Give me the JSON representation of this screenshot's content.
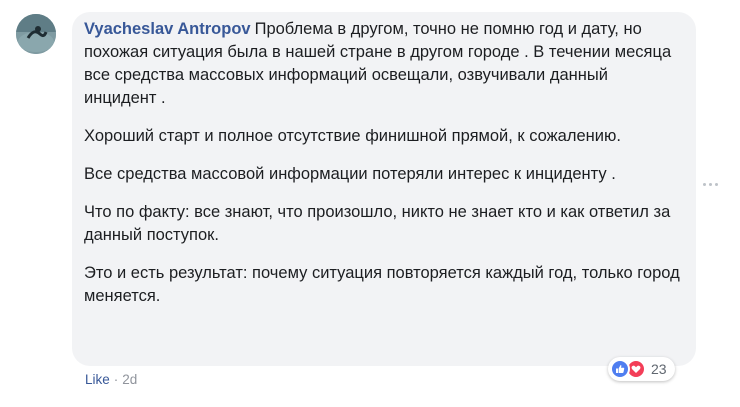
{
  "comment": {
    "author": "Vyacheslav Antropov",
    "paragraphs": [
      "Проблема в другом, точно не помню год и дату, но похожая ситуация была в нашей стране в другом городе . В течении месяца все средства массовых информаций освещали, озвучивали данный инцидент .",
      "Хороший старт и полное отсутствие финишной прямой, к сожалению.",
      "Все средства массовой информации потеряли интерес к инциденту .",
      "Что по факту: все знают, что произошло, никто не знает кто и как ответил за данный поступок.",
      "Это и есть результат: почему ситуация повторяется каждый год, только город меняется."
    ],
    "reactions": {
      "icons": [
        "like-icon",
        "love-icon"
      ],
      "count": "23",
      "like_color": "#4f7ef0",
      "love_color": "#f33e58"
    },
    "actions": {
      "like_label": "Like",
      "separator": "·",
      "time": "2d"
    },
    "colors": {
      "author": "#385898",
      "bubble": "#f2f3f5",
      "meta": "#90949c"
    }
  }
}
